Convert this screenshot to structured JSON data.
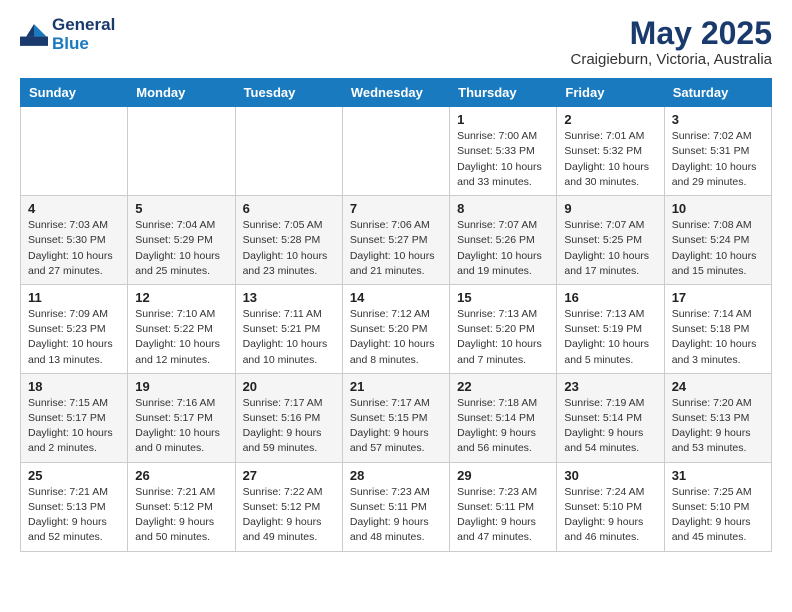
{
  "header": {
    "logo_line1": "General",
    "logo_line2": "Blue",
    "month": "May 2025",
    "location": "Craigieburn, Victoria, Australia"
  },
  "days_of_week": [
    "Sunday",
    "Monday",
    "Tuesday",
    "Wednesday",
    "Thursday",
    "Friday",
    "Saturday"
  ],
  "weeks": [
    [
      {
        "day": "",
        "info": ""
      },
      {
        "day": "",
        "info": ""
      },
      {
        "day": "",
        "info": ""
      },
      {
        "day": "",
        "info": ""
      },
      {
        "day": "1",
        "info": "Sunrise: 7:00 AM\nSunset: 5:33 PM\nDaylight: 10 hours\nand 33 minutes."
      },
      {
        "day": "2",
        "info": "Sunrise: 7:01 AM\nSunset: 5:32 PM\nDaylight: 10 hours\nand 30 minutes."
      },
      {
        "day": "3",
        "info": "Sunrise: 7:02 AM\nSunset: 5:31 PM\nDaylight: 10 hours\nand 29 minutes."
      }
    ],
    [
      {
        "day": "4",
        "info": "Sunrise: 7:03 AM\nSunset: 5:30 PM\nDaylight: 10 hours\nand 27 minutes."
      },
      {
        "day": "5",
        "info": "Sunrise: 7:04 AM\nSunset: 5:29 PM\nDaylight: 10 hours\nand 25 minutes."
      },
      {
        "day": "6",
        "info": "Sunrise: 7:05 AM\nSunset: 5:28 PM\nDaylight: 10 hours\nand 23 minutes."
      },
      {
        "day": "7",
        "info": "Sunrise: 7:06 AM\nSunset: 5:27 PM\nDaylight: 10 hours\nand 21 minutes."
      },
      {
        "day": "8",
        "info": "Sunrise: 7:07 AM\nSunset: 5:26 PM\nDaylight: 10 hours\nand 19 minutes."
      },
      {
        "day": "9",
        "info": "Sunrise: 7:07 AM\nSunset: 5:25 PM\nDaylight: 10 hours\nand 17 minutes."
      },
      {
        "day": "10",
        "info": "Sunrise: 7:08 AM\nSunset: 5:24 PM\nDaylight: 10 hours\nand 15 minutes."
      }
    ],
    [
      {
        "day": "11",
        "info": "Sunrise: 7:09 AM\nSunset: 5:23 PM\nDaylight: 10 hours\nand 13 minutes."
      },
      {
        "day": "12",
        "info": "Sunrise: 7:10 AM\nSunset: 5:22 PM\nDaylight: 10 hours\nand 12 minutes."
      },
      {
        "day": "13",
        "info": "Sunrise: 7:11 AM\nSunset: 5:21 PM\nDaylight: 10 hours\nand 10 minutes."
      },
      {
        "day": "14",
        "info": "Sunrise: 7:12 AM\nSunset: 5:20 PM\nDaylight: 10 hours\nand 8 minutes."
      },
      {
        "day": "15",
        "info": "Sunrise: 7:13 AM\nSunset: 5:20 PM\nDaylight: 10 hours\nand 7 minutes."
      },
      {
        "day": "16",
        "info": "Sunrise: 7:13 AM\nSunset: 5:19 PM\nDaylight: 10 hours\nand 5 minutes."
      },
      {
        "day": "17",
        "info": "Sunrise: 7:14 AM\nSunset: 5:18 PM\nDaylight: 10 hours\nand 3 minutes."
      }
    ],
    [
      {
        "day": "18",
        "info": "Sunrise: 7:15 AM\nSunset: 5:17 PM\nDaylight: 10 hours\nand 2 minutes."
      },
      {
        "day": "19",
        "info": "Sunrise: 7:16 AM\nSunset: 5:17 PM\nDaylight: 10 hours\nand 0 minutes."
      },
      {
        "day": "20",
        "info": "Sunrise: 7:17 AM\nSunset: 5:16 PM\nDaylight: 9 hours\nand 59 minutes."
      },
      {
        "day": "21",
        "info": "Sunrise: 7:17 AM\nSunset: 5:15 PM\nDaylight: 9 hours\nand 57 minutes."
      },
      {
        "day": "22",
        "info": "Sunrise: 7:18 AM\nSunset: 5:14 PM\nDaylight: 9 hours\nand 56 minutes."
      },
      {
        "day": "23",
        "info": "Sunrise: 7:19 AM\nSunset: 5:14 PM\nDaylight: 9 hours\nand 54 minutes."
      },
      {
        "day": "24",
        "info": "Sunrise: 7:20 AM\nSunset: 5:13 PM\nDaylight: 9 hours\nand 53 minutes."
      }
    ],
    [
      {
        "day": "25",
        "info": "Sunrise: 7:21 AM\nSunset: 5:13 PM\nDaylight: 9 hours\nand 52 minutes."
      },
      {
        "day": "26",
        "info": "Sunrise: 7:21 AM\nSunset: 5:12 PM\nDaylight: 9 hours\nand 50 minutes."
      },
      {
        "day": "27",
        "info": "Sunrise: 7:22 AM\nSunset: 5:12 PM\nDaylight: 9 hours\nand 49 minutes."
      },
      {
        "day": "28",
        "info": "Sunrise: 7:23 AM\nSunset: 5:11 PM\nDaylight: 9 hours\nand 48 minutes."
      },
      {
        "day": "29",
        "info": "Sunrise: 7:23 AM\nSunset: 5:11 PM\nDaylight: 9 hours\nand 47 minutes."
      },
      {
        "day": "30",
        "info": "Sunrise: 7:24 AM\nSunset: 5:10 PM\nDaylight: 9 hours\nand 46 minutes."
      },
      {
        "day": "31",
        "info": "Sunrise: 7:25 AM\nSunset: 5:10 PM\nDaylight: 9 hours\nand 45 minutes."
      }
    ]
  ]
}
